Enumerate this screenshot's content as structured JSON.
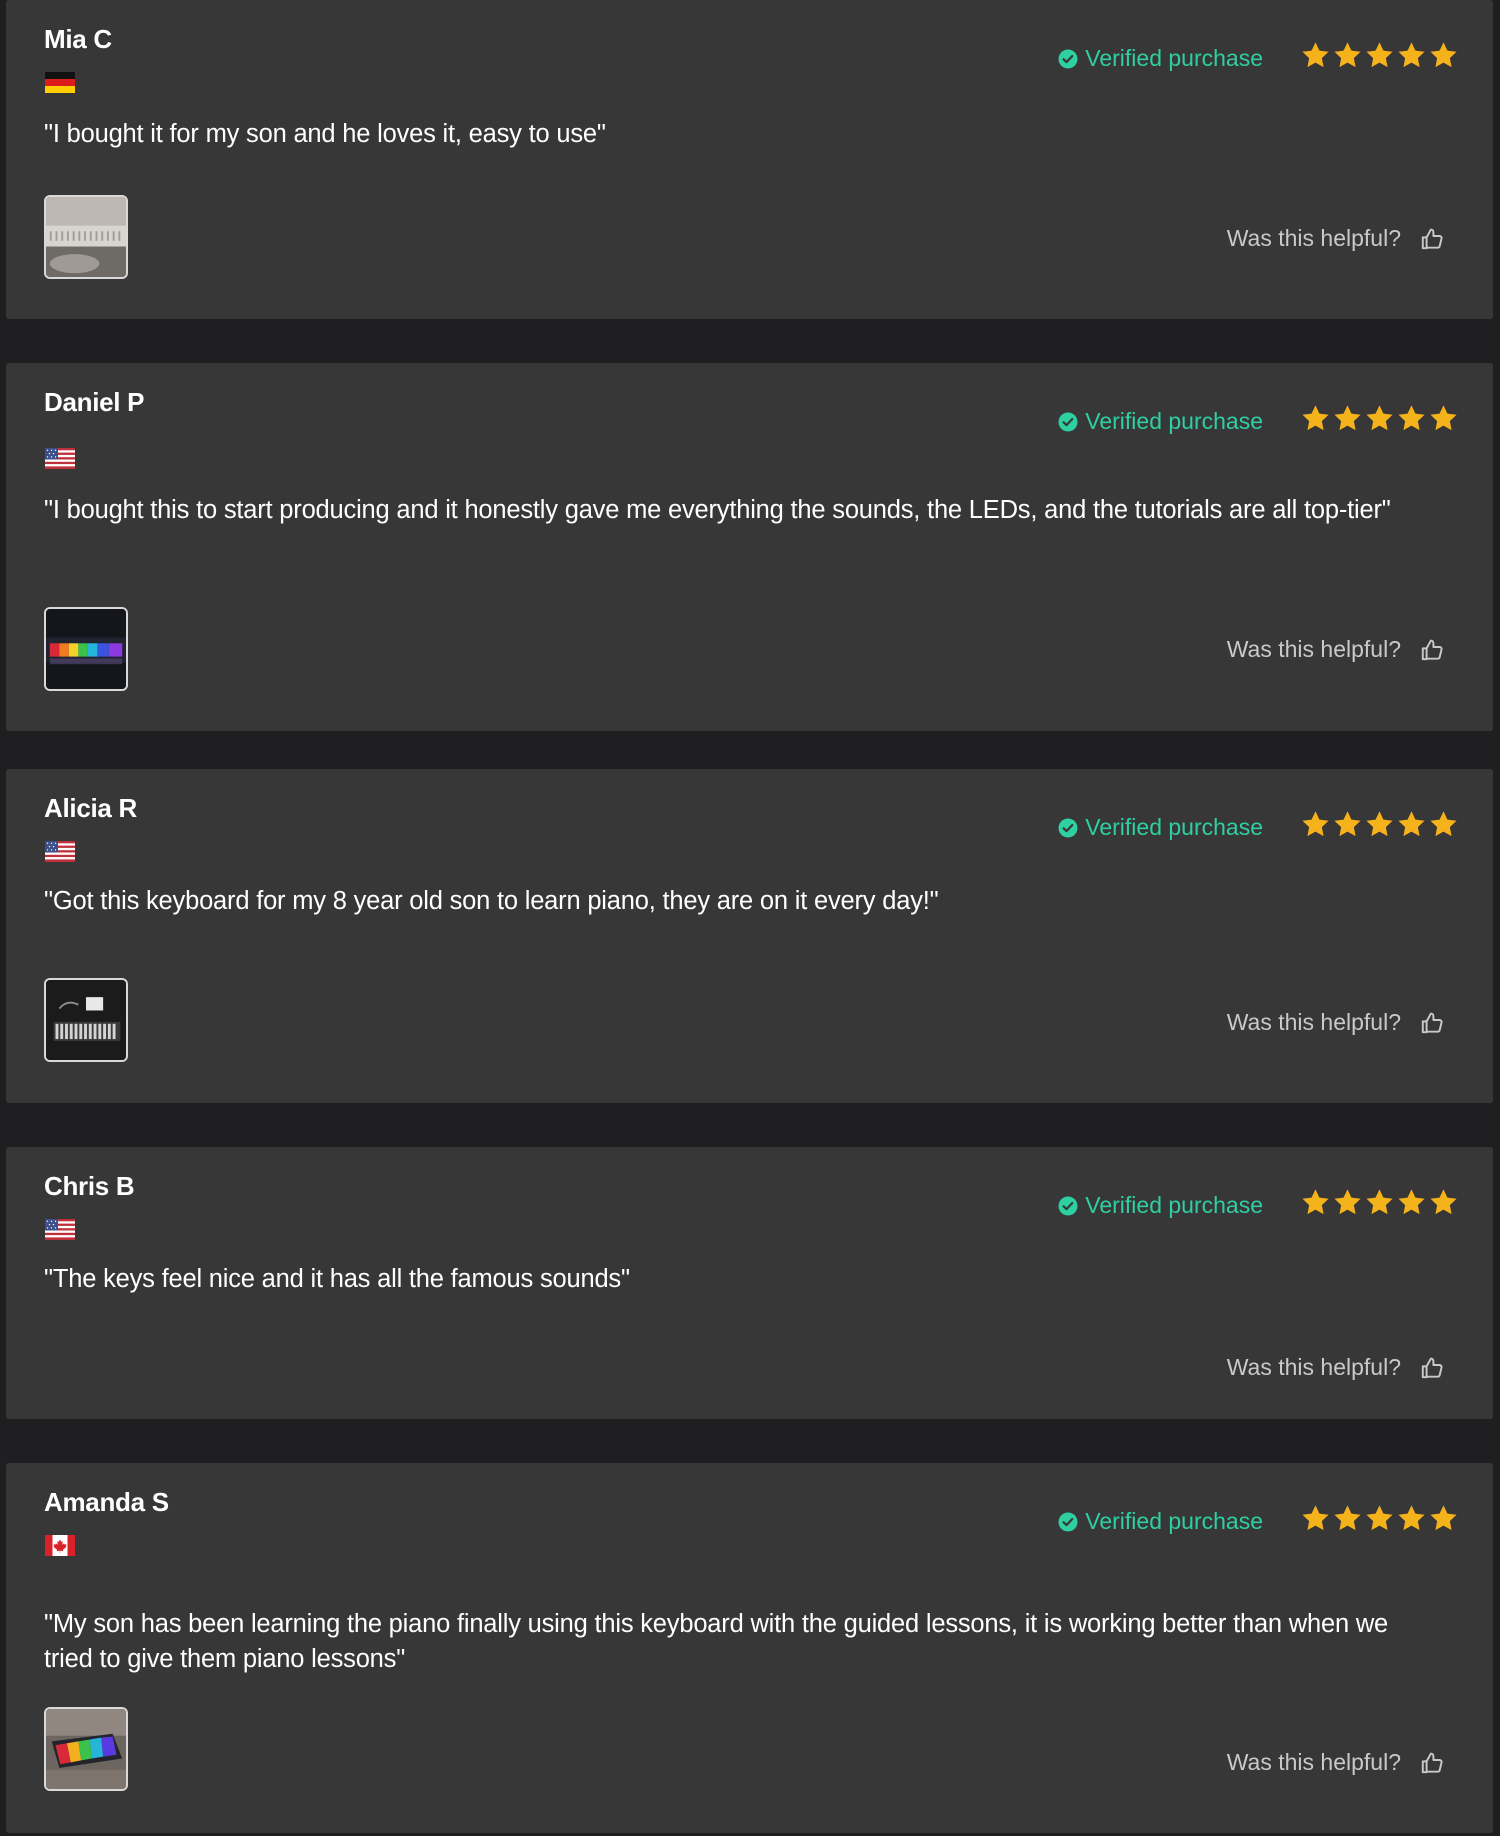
{
  "reviews": [
    {
      "name": "Mia C",
      "country": "Germany",
      "flag_icon": "flag-germany-icon",
      "verified_label": "Verified purchase",
      "rating": 5,
      "text": "\"I bought it for my son and he loves it, easy to use\"",
      "has_photo": true,
      "helpful_label": "Was this helpful?"
    },
    {
      "name": "Daniel P",
      "country": "United States",
      "flag_icon": "flag-usa-icon",
      "verified_label": "Verified purchase",
      "rating": 5,
      "text": "\"I bought this to start producing and it honestly gave me everything the sounds, the LEDs, and the tutorials are all top-tier\"",
      "has_photo": true,
      "helpful_label": "Was this helpful?"
    },
    {
      "name": "Alicia R",
      "country": "United States",
      "flag_icon": "flag-usa-icon",
      "verified_label": "Verified purchase",
      "rating": 5,
      "text": "\"Got this keyboard for my 8 year old son to learn piano, they are on it every day!\"",
      "has_photo": true,
      "helpful_label": "Was this helpful?"
    },
    {
      "name": "Chris B",
      "country": "United States",
      "flag_icon": "flag-usa-icon",
      "verified_label": "Verified purchase",
      "rating": 5,
      "text": "\"The keys feel nice and it has all the famous sounds\"",
      "has_photo": false,
      "helpful_label": "Was this helpful?"
    },
    {
      "name": "Amanda S",
      "country": "Canada",
      "flag_icon": "flag-canada-icon",
      "verified_label": "Verified purchase",
      "rating": 5,
      "text": "\"My son has been learning the piano finally using this keyboard with the guided lessons, it is working better than when we tried to give them piano lessons\"",
      "has_photo": true,
      "helpful_label": "Was this helpful?"
    }
  ],
  "colors": {
    "page_background": "#1f1f21",
    "card_background": "#383737",
    "verified": "#2ecfa0",
    "star": "#f6b21b",
    "helpful_text": "#c9c9c9"
  }
}
